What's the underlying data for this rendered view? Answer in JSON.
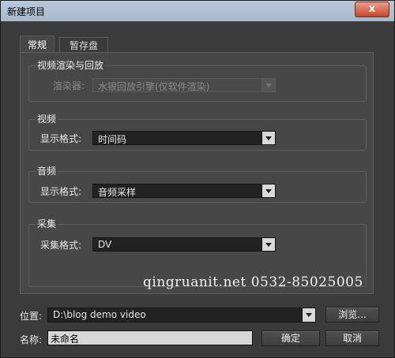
{
  "window": {
    "title": "新建项目",
    "close_glyph": "x"
  },
  "tabs": [
    {
      "label": "常规",
      "active": true
    },
    {
      "label": "暂存盘",
      "active": false
    }
  ],
  "groups": {
    "render": {
      "title": "视频渲染与回放",
      "renderer_label": "渲染器:",
      "renderer_value": "水银回放引擎(仅软件渲染)"
    },
    "video": {
      "title": "视频",
      "format_label": "显示格式:",
      "format_value": "时间码"
    },
    "audio": {
      "title": "音频",
      "format_label": "显示格式:",
      "format_value": "音频采样"
    },
    "capture": {
      "title": "采集",
      "format_label": "采集格式:",
      "format_value": "DV"
    }
  },
  "watermark": "qingruanit.net 0532-85025005",
  "location": {
    "label": "位置:",
    "value": "D:\\blog demo video",
    "browse_label": "浏览..."
  },
  "name": {
    "label": "名称:",
    "value": "未命名"
  },
  "buttons": {
    "ok": "确定",
    "cancel": "取消"
  }
}
